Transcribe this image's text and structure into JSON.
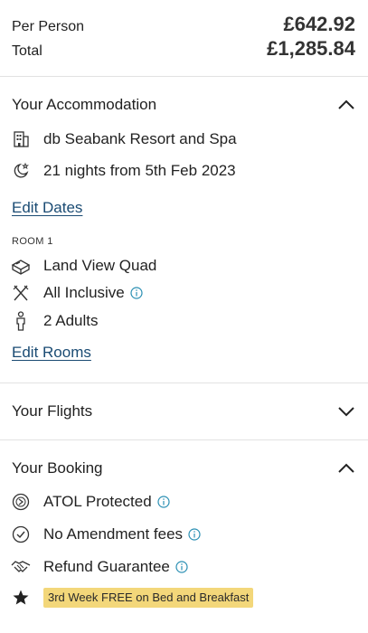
{
  "summary": {
    "per_person_label": "Per Person",
    "per_person_value": "£642.92",
    "total_label": "Total",
    "total_value": "£1,285.84"
  },
  "accommodation": {
    "title": "Your Accommodation",
    "hotel": "db Seabank Resort and Spa",
    "dates": "21 nights from 5th Feb 2023",
    "edit_dates": "Edit Dates",
    "room_label": "ROOM 1",
    "room_type": "Land View Quad",
    "board": "All Inclusive",
    "guests": "2 Adults",
    "edit_rooms": "Edit Rooms"
  },
  "flights": {
    "title": "Your Flights"
  },
  "booking": {
    "title": "Your Booking",
    "atol": "ATOL Protected",
    "amendment": "No Amendment fees",
    "refund": "Refund Guarantee",
    "promo": "3rd Week FREE on Bed and Breakfast"
  },
  "colors": {
    "link": "#1a4b73",
    "info_icon": "#2a8fb3",
    "promo_bg": "#f3d77a"
  },
  "icons": [
    "building-icon",
    "moon-star-icon",
    "bed-icon",
    "cutlery-icon",
    "person-icon",
    "atol-icon",
    "check-circle-icon",
    "handshake-icon",
    "star-icon",
    "info-icon",
    "chevron-up-icon",
    "chevron-down-icon"
  ]
}
